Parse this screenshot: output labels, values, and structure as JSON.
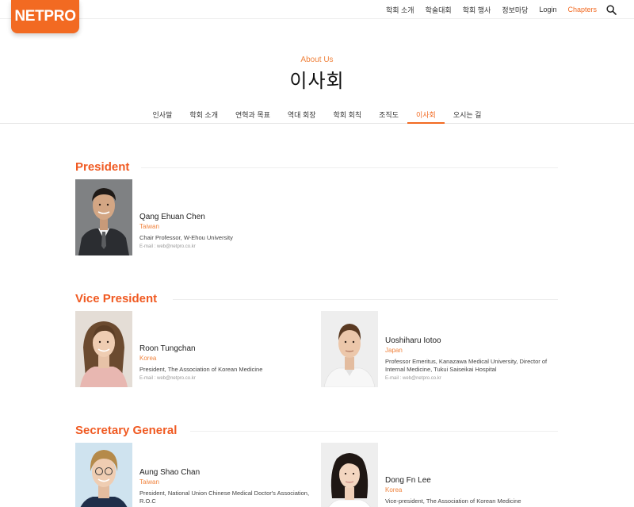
{
  "header": {
    "logo_text": "NETPRO",
    "nav": [
      {
        "label": "학회 소개"
      },
      {
        "label": "학술대회"
      },
      {
        "label": "학회 행사"
      },
      {
        "label": "정보마당"
      },
      {
        "label": "Login"
      },
      {
        "label": "Chapters"
      }
    ],
    "search_icon": "search-icon",
    "accent_color": "#f26a22"
  },
  "hero": {
    "eyebrow": "About Us",
    "title": "이사회"
  },
  "subnav": {
    "items": [
      {
        "label": "인사말"
      },
      {
        "label": "학회 소개"
      },
      {
        "label": "연혁과 목표"
      },
      {
        "label": "역대 회장"
      },
      {
        "label": "학회 회칙"
      },
      {
        "label": "조직도"
      },
      {
        "label": "이사회"
      },
      {
        "label": "오시는 길"
      }
    ],
    "active": "이사회"
  },
  "sections": {
    "president": {
      "title": "President",
      "members": [
        {
          "name": "Qang Ehuan Chen",
          "country": "Taiwan",
          "title": "Chair Professor, W-Ehou University",
          "email": "E-mail : web@netpro.co.kr"
        }
      ]
    },
    "vice_president": {
      "title": "Vice President",
      "members": [
        {
          "name": "Roon Tungchan",
          "country": "Korea",
          "title": "President, The Association of Korean Medicine",
          "email": "E-mail : web@netpro.co.kr"
        },
        {
          "name": "Uoshiharu Iotoo",
          "country": "Japan",
          "title": "Professor Emeritus, Kanazawa Medical University, Director of Internal Medicine, Tukui Saiseikai Hospital",
          "email": "E-mail : web@netpro.co.kr"
        }
      ]
    },
    "secretary_general": {
      "title": "Secretary General",
      "members": [
        {
          "name": "Aung Shao Chan",
          "country": "Taiwan",
          "title": "President, National Union Chinese Medical Doctor's Association, R.O.C"
        },
        {
          "name": "Dong Fn Lee",
          "country": "Korea",
          "title": "Vice-president, The Association of Korean Medicine"
        }
      ]
    }
  }
}
